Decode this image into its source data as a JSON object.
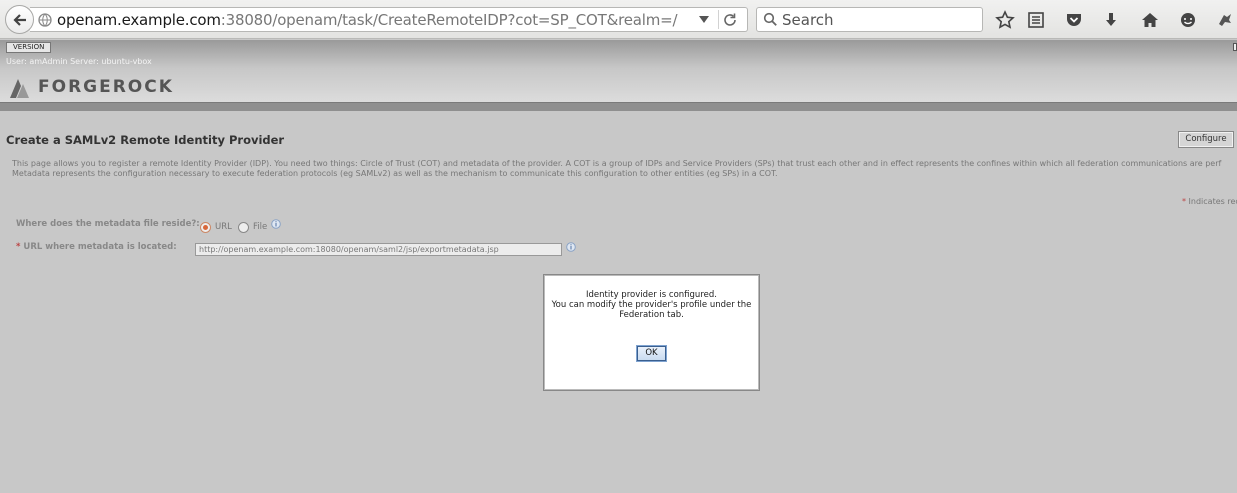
{
  "browser": {
    "url_host": "openam.example.com",
    "url_rest": ":38080/openam/task/CreateRemoteIDP?cot=SP_COT&realm=/",
    "search_placeholder": "Search"
  },
  "header": {
    "version_label": "VERSION",
    "user_info": "User: amAdmin   Server: ubuntu-vbox",
    "logo_text": "FORGEROCK"
  },
  "page": {
    "title": "Create a SAMLv2 Remote Identity Provider",
    "configure_label": "Configure",
    "description_line1": "This page allows you to register a remote Identity Provider (IDP). You need two things: Circle of Trust (COT) and metadata of the provider. A COT is a group of IDPs and Service Providers (SPs) that trust each other and in effect represents the confines within which all federation communications are perf",
    "description_line2": "Metadata represents the configuration necessary to execute federation protocols (eg SAMLv2) as well as the mechanism to communicate this configuration to other entities (eg SPs) in a COT.",
    "required_note": "Indicates rec",
    "metadata_location_label": "Where does the metadata file reside?:",
    "option_url": "URL",
    "option_file": "File",
    "url_field_label": "URL where metadata is located:",
    "url_field_value": "http://openam.example.com:18080/openam/saml2/jsp/exportmetadata.jsp"
  },
  "modal": {
    "line1": "Identity provider is configured.",
    "line2": "You can modify the provider's profile under the",
    "line3": "Federation tab.",
    "ok_label": "OK"
  },
  "icons": [
    "back-arrow-icon",
    "globe-icon",
    "reload-icon",
    "search-icon",
    "star-icon",
    "reading-list-icon",
    "pocket-icon",
    "download-icon",
    "home-icon",
    "chat-icon",
    "extension-icon",
    "info-icon",
    "forgerock-logo-icon"
  ],
  "colors": {
    "page_bg": "#c8c8c8",
    "radio_selected": "#d8673a",
    "required_star": "#bb4444"
  }
}
